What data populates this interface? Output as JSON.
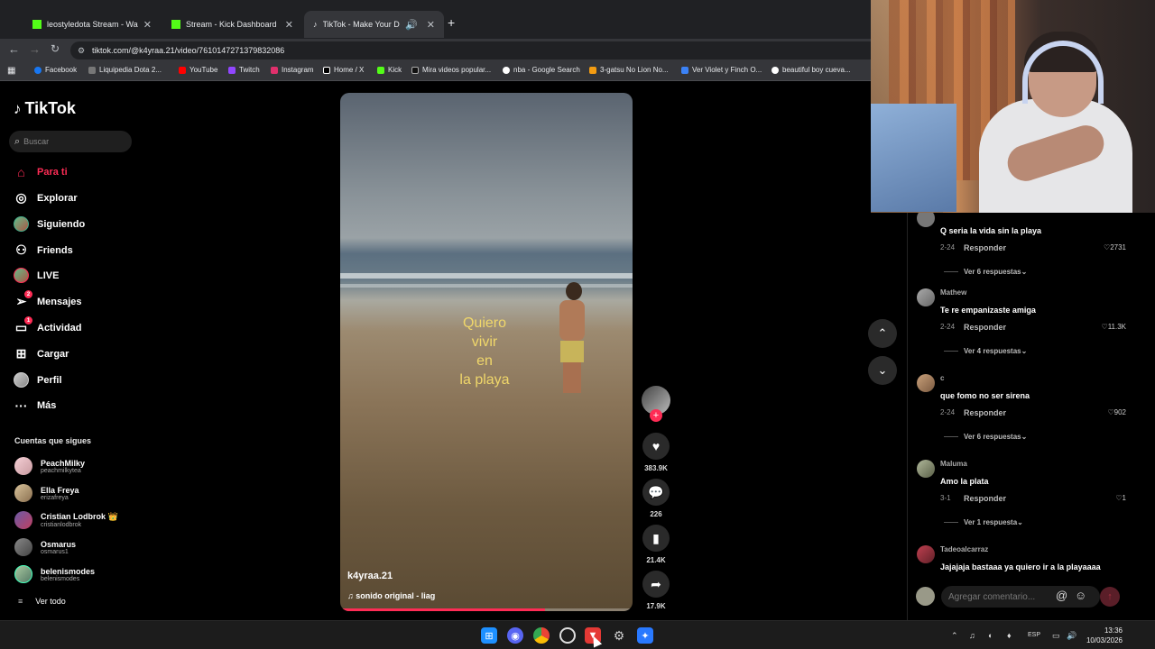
{
  "browser": {
    "tabs": [
      {
        "title": "leostyledota Stream - Watch Li...",
        "favicon_color": "#53fc18",
        "active": false
      },
      {
        "title": "Stream - Kick Dashboard",
        "favicon_color": "#53fc18",
        "active": false
      },
      {
        "title": "TikTok - Make Your Day",
        "favicon_color": "#ffffff",
        "active": true
      }
    ],
    "url": "tiktok.com/@k4yraa.21/video/7610147271379832086",
    "bookmarks": [
      "Facebook",
      "Liquipedia Dota 2...",
      "YouTube",
      "Twitch",
      "Instagram",
      "Home / X",
      "Kick",
      "Mira videos popular...",
      "nba - Google Search",
      "3-gatsu No Lion No...",
      "Ver Violet y Finch O...",
      "beautiful boy cueva..."
    ]
  },
  "tiktok": {
    "logo": "TikTok",
    "search_placeholder": "Buscar",
    "nav": [
      {
        "label": "Para ti",
        "icon": "home-icon"
      },
      {
        "label": "Explorar",
        "icon": "compass-icon"
      },
      {
        "label": "Siguiendo",
        "icon": "following-icon"
      },
      {
        "label": "Friends",
        "icon": "friends-icon"
      },
      {
        "label": "LIVE",
        "icon": "live-icon"
      },
      {
        "label": "Mensajes",
        "icon": "messages-icon",
        "badge": "2"
      },
      {
        "label": "Actividad",
        "icon": "activity-icon",
        "badge": "1"
      },
      {
        "label": "Cargar",
        "icon": "upload-icon"
      },
      {
        "label": "Perfil",
        "icon": "profile-icon"
      },
      {
        "label": "Más",
        "icon": "more-icon"
      }
    ],
    "following_title": "Cuentas que sigues",
    "following": [
      {
        "name": "PeachMilky",
        "handle": "peachmilkytea"
      },
      {
        "name": "Ella Freya",
        "handle": "erizafreya"
      },
      {
        "name": "Cristian Lodbrok 👑",
        "handle": "cristianlodbrok"
      },
      {
        "name": "Osmarus",
        "handle": "osmarus1"
      },
      {
        "name": "belenismodes",
        "handle": "belenismodes"
      }
    ],
    "see_all": "Ver todo"
  },
  "video": {
    "caption_lines": [
      "Quiero",
      "vivir",
      "en",
      "la playa"
    ],
    "username": "k4yraa.21",
    "music": "sonido original - liag",
    "progress": 0.7,
    "likes": "383.9K",
    "comments": "226",
    "saves": "21.4K",
    "shares": "17.9K"
  },
  "comments": [
    {
      "user": "",
      "text": "Q seria la vida sin la playa",
      "date": "2-24",
      "reply": "Responder",
      "likes": "2731",
      "more": "Ver 6 respuestas"
    },
    {
      "user": "Mathew",
      "text": "Te re empanizaste amiga",
      "date": "2-24",
      "reply": "Responder",
      "likes": "11.3K",
      "more": "Ver 4 respuestas"
    },
    {
      "user": "c",
      "text": "que fomo no ser sirena",
      "date": "2-24",
      "reply": "Responder",
      "likes": "902",
      "more": "Ver 6 respuestas"
    },
    {
      "user": "Maluma",
      "text": "Amo la plata",
      "date": "3-1",
      "reply": "Responder",
      "likes": "1",
      "more": "Ver 1 respuesta"
    },
    {
      "user": "Tadeoalcarraz",
      "text": "Jajajaja bastaaa ya quiero ir a la playaaaa",
      "date": "",
      "reply": "",
      "likes": "",
      "more": ""
    }
  ],
  "add_comment_placeholder": "Agregar comentario...",
  "taskbar": {
    "lang": "ESP",
    "time": "13:36",
    "date": "10/03/2026"
  }
}
